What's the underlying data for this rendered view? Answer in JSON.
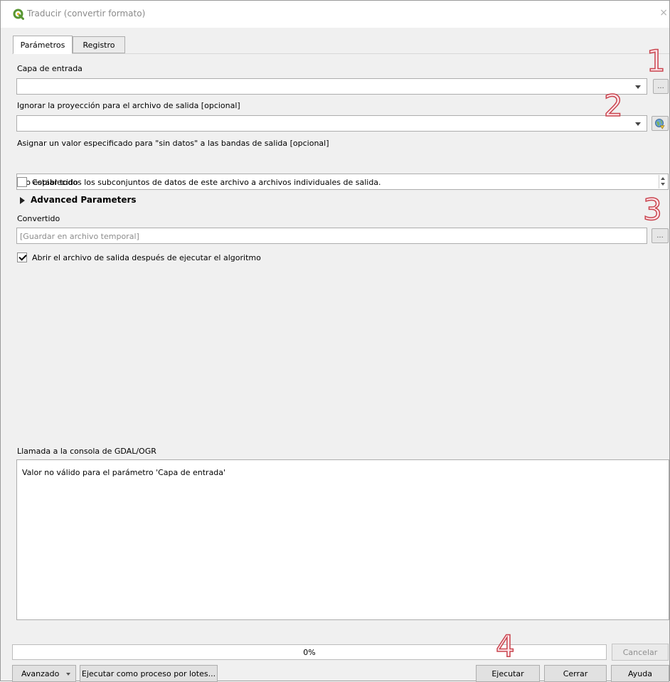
{
  "window": {
    "title": "Traducir (convertir formato)",
    "close_glyph": "×"
  },
  "tabs": [
    {
      "label": "Parámetros",
      "active": true
    },
    {
      "label": "Registro",
      "active": false
    }
  ],
  "params": {
    "input_layer": {
      "label": "Capa de entrada",
      "value": "",
      "browse_label": "..."
    },
    "projection": {
      "label": "Ignorar la proyección para el archivo de salida [opcional]",
      "value": "",
      "icon": "crs-globe-icon"
    },
    "nodata": {
      "label": "Asignar un valor especificado para \"sin datos\" a las bandas de salida [opcional]",
      "value": "No establecido"
    },
    "copy_subdatasets": {
      "label": "Copiar todos los subconjuntos de datos de este archivo a archivos individuales de salida.",
      "checked": false
    },
    "advanced": {
      "label": "Advanced Parameters",
      "expanded": false
    },
    "output": {
      "label": "Convertido",
      "placeholder": "[Guardar en archivo temporal]",
      "browse_label": "..."
    },
    "open_output": {
      "label": "Abrir el archivo de salida después de ejecutar el algoritmo",
      "checked": true
    }
  },
  "console": {
    "label": "Llamada a la consola de GDAL/OGR",
    "text": "Valor no válido para el parámetro 'Capa de entrada'"
  },
  "progress": {
    "percent": 0,
    "text": "0%"
  },
  "buttons": {
    "cancel": "Cancelar",
    "advanced": "Avanzado",
    "batch": "Ejecutar como proceso por lotes...",
    "run": "Ejecutar",
    "close": "Cerrar",
    "help": "Ayuda"
  },
  "annotations": [
    "1",
    "2",
    "3",
    "4"
  ],
  "colors": {
    "annotation_stroke": "#c9454f",
    "annotation_fill": "#ffe7ec",
    "qgis_green": "#589632"
  }
}
